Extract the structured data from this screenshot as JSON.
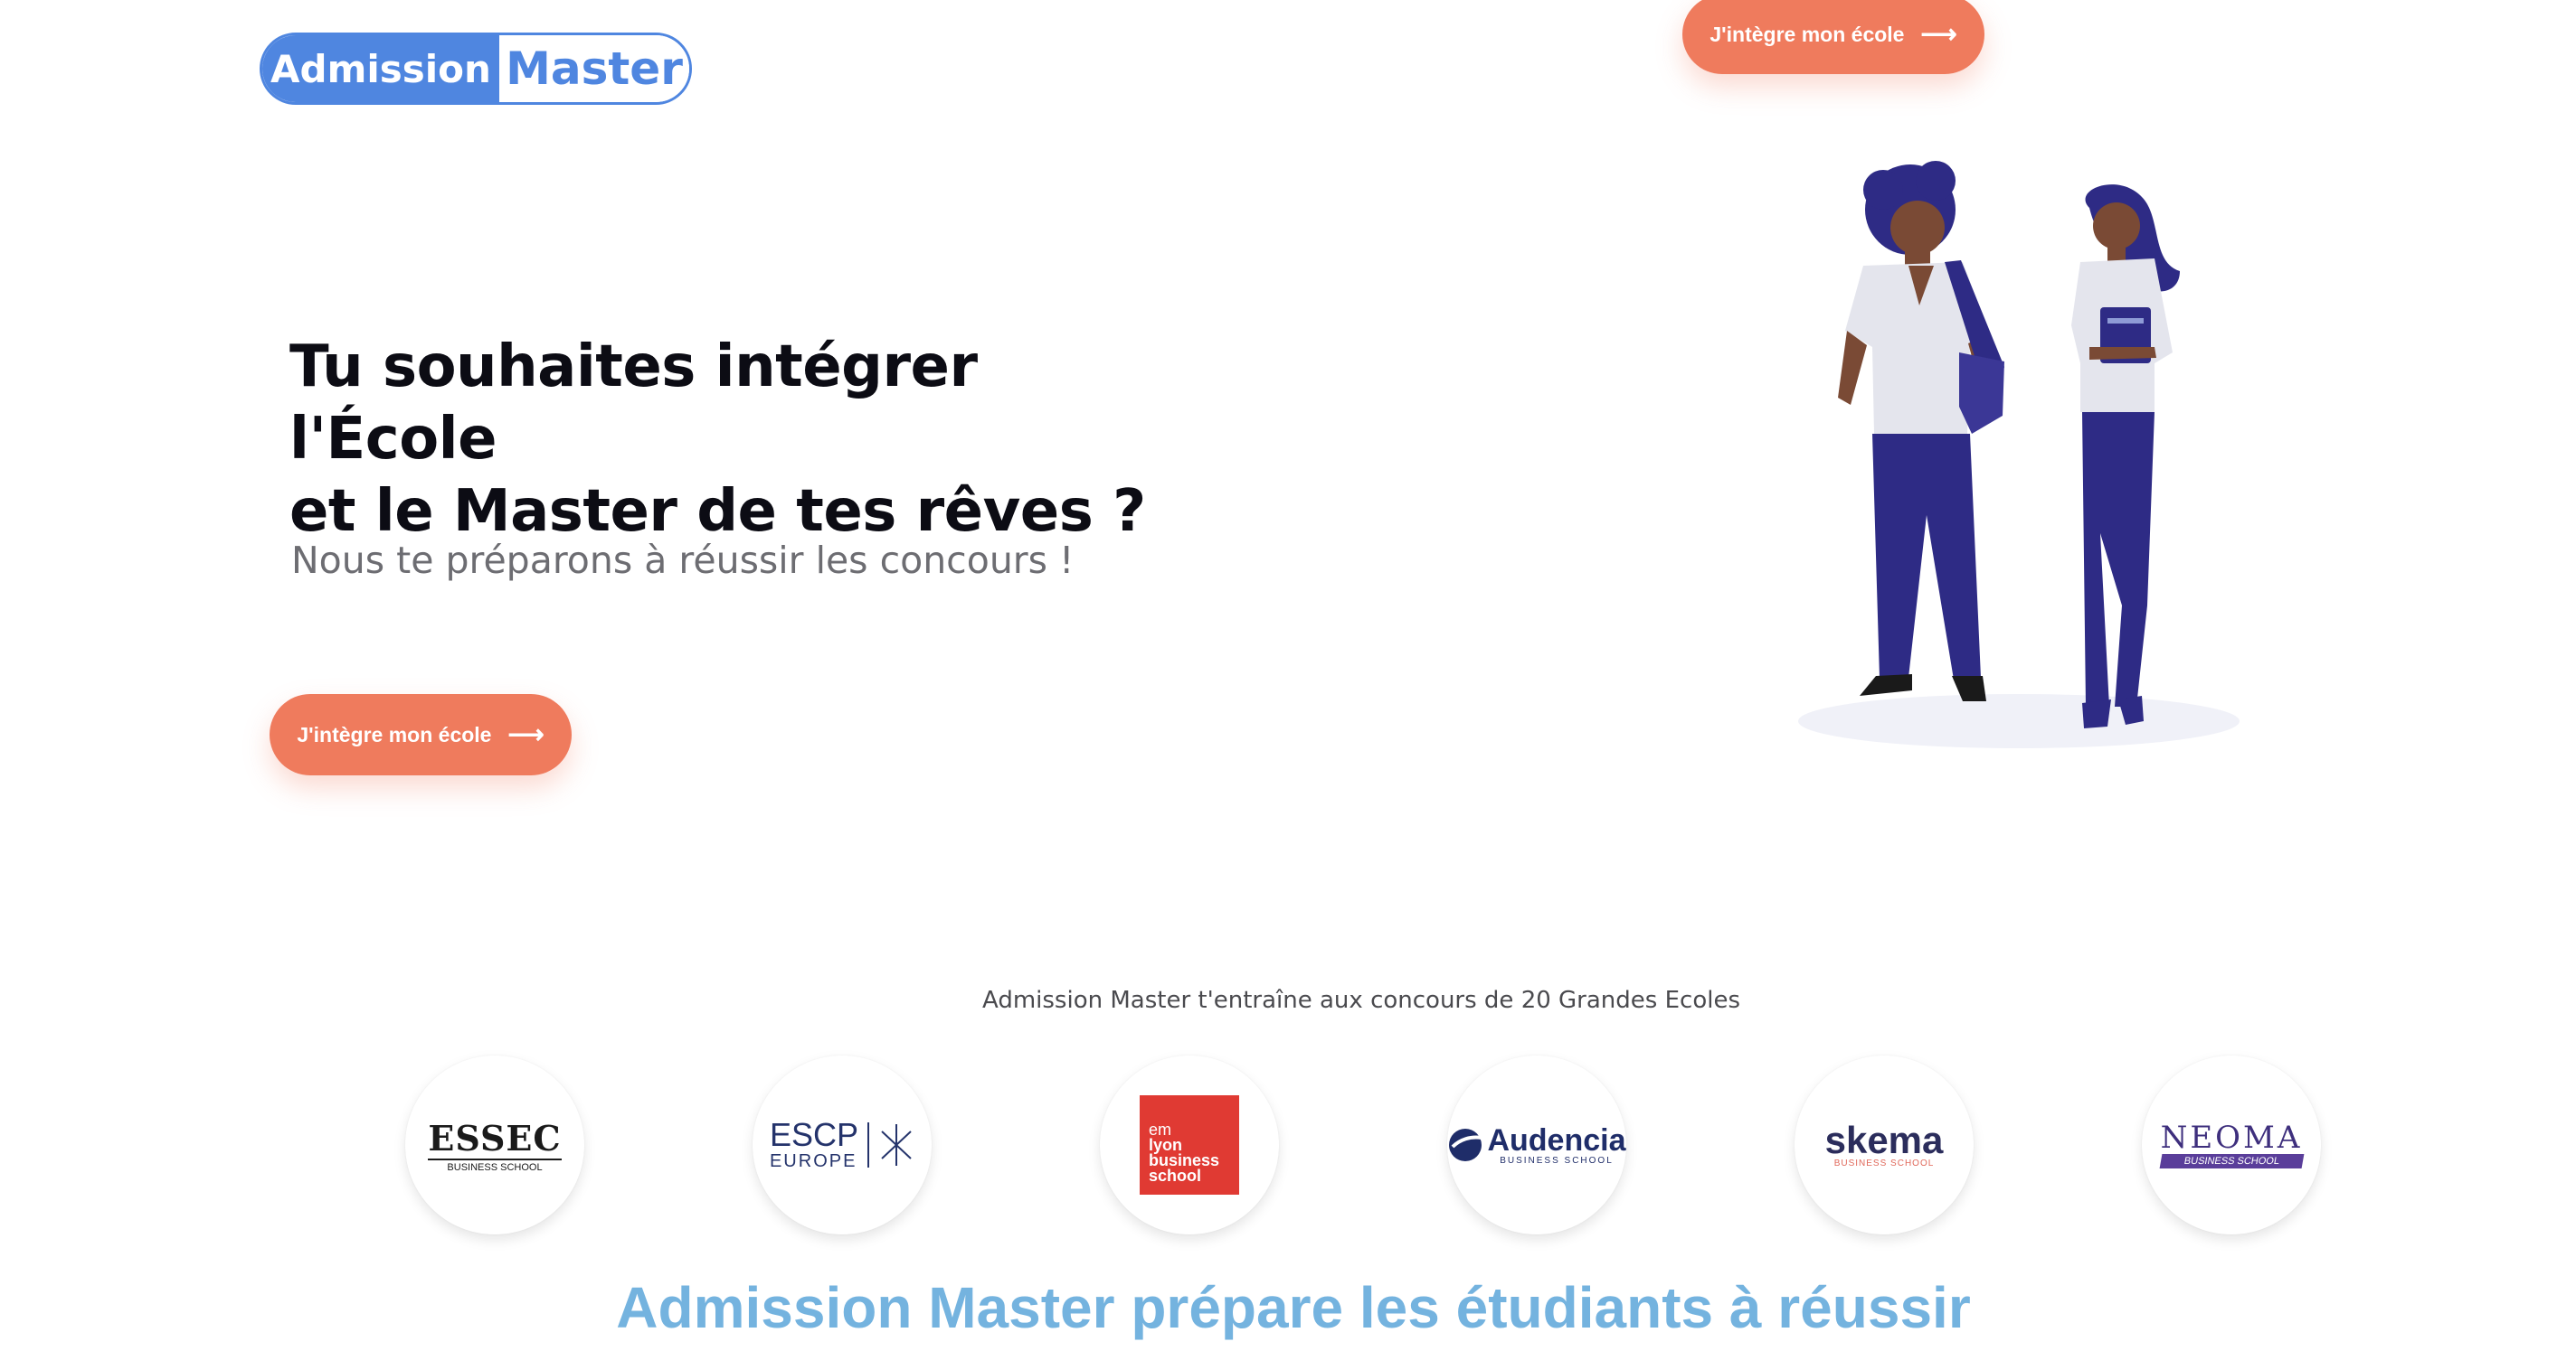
{
  "header": {
    "logo_left": "Admission",
    "logo_right": "Master",
    "cta_label": "J'intègre mon école"
  },
  "hero": {
    "title_line1": "Tu souhaites intégrer l'École",
    "title_line2": "et le Master de tes rêves ?",
    "subtitle": "Nous te préparons à réussir les concours !",
    "cta_label": "J'intègre mon école"
  },
  "schools": {
    "caption": "Admission Master t'entraîne aux concours de 20 Grandes Ecoles",
    "items": [
      {
        "name": "ESSEC",
        "tag": "BUSINESS SCHOOL"
      },
      {
        "name": "ESCP",
        "tag": "EUROPE"
      },
      {
        "name": "em lyon business school",
        "line1": "em",
        "line2": "lyon",
        "line3": "business",
        "line4": "school"
      },
      {
        "name": "Audencia",
        "tag": "BUSINESS SCHOOL"
      },
      {
        "name": "skema",
        "tag": "BUSINESS SCHOOL"
      },
      {
        "name": "NEOMA",
        "tag": "BUSINESS SCHOOL"
      }
    ]
  },
  "section": {
    "title": "Admission Master prépare les étudiants à réussir"
  },
  "colors": {
    "brand_blue": "#4f86e0",
    "cta_orange": "#ef7b5d",
    "section_title_blue": "#74b3df",
    "figure_navy": "#2e2b85"
  },
  "icons": {
    "cta_arrow": "arrow-right-icon"
  }
}
